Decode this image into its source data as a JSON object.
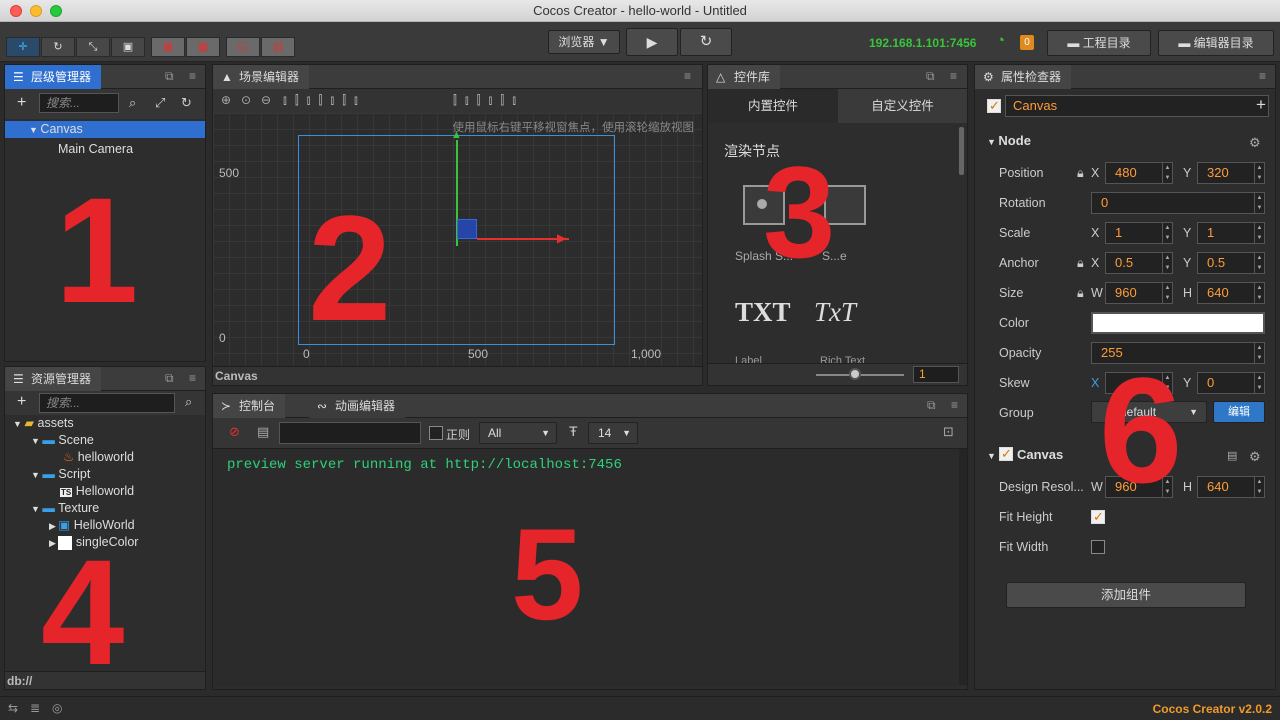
{
  "window": {
    "title": "Cocos Creator - hello-world - Untitled"
  },
  "toolbar": {
    "preview_select": "浏览器 ▼",
    "ip": "192.168.1.101:7456",
    "badge": "0",
    "project_btn": "工程目录",
    "editor_btn": "编辑器目录"
  },
  "hierarchy": {
    "tab": "层级管理器",
    "search_placeholder": "搜索...",
    "nodes": [
      "Canvas",
      "Main Camera"
    ],
    "marker": "1"
  },
  "scene": {
    "tab": "场景编辑器",
    "hint": "使用鼠标右键平移视窗焦点，使用滚轮缩放视图",
    "y_labels": [
      "500",
      "0"
    ],
    "x_labels": [
      "0",
      "500",
      "1,000"
    ],
    "footer": "Canvas",
    "marker": "2"
  },
  "widgets": {
    "tab": "控件库",
    "tab_builtin": "内置控件",
    "tab_custom": "自定义控件",
    "section": "渲染节点",
    "items": [
      "Splash S...",
      "S...e",
      "TXT",
      "TxT",
      "Label",
      "Rich Text"
    ],
    "zoom_value": "1",
    "marker": "3"
  },
  "assets": {
    "tab": "资源管理器",
    "search_placeholder": "搜索...",
    "tree": [
      "assets",
      "Scene",
      "helloworld",
      "Script",
      "Helloworld",
      "Texture",
      "HelloWorld",
      "singleColor"
    ],
    "footer": "db://",
    "marker": "4"
  },
  "console": {
    "tab": "控制台",
    "tab_anim": "动画编辑器",
    "regex_label": "正则",
    "filter": "All",
    "font_size": "14",
    "log": "preview server running at http://localhost:7456",
    "marker": "5"
  },
  "inspector": {
    "tab": "属性检查器",
    "node_name": "Canvas",
    "node_section": "Node",
    "position": {
      "label": "Position",
      "x": "480",
      "y": "320"
    },
    "rotation": {
      "label": "Rotation",
      "value": "0"
    },
    "scale": {
      "label": "Scale",
      "x": "1",
      "y": "1"
    },
    "anchor": {
      "label": "Anchor",
      "x": "0.5",
      "y": "0.5"
    },
    "size": {
      "label": "Size",
      "w": "960",
      "h": "640"
    },
    "color_label": "Color",
    "opacity": {
      "label": "Opacity",
      "value": "255"
    },
    "skew": {
      "label": "Skew",
      "y": "0"
    },
    "group": {
      "label": "Group",
      "value": "default",
      "edit": "编辑"
    },
    "canvas_section": "Canvas",
    "design": {
      "label": "Design Resol...",
      "w": "960",
      "h": "640"
    },
    "fit_height": "Fit Height",
    "fit_width": "Fit Width",
    "add_component": "添加组件",
    "marker": "6"
  },
  "status": {
    "version": "Cocos Creator v2.0.2"
  },
  "colors": {
    "accent": "#2f6fd0",
    "ip_green": "#3ac43a",
    "marker_red": "#e5252a",
    "value_orange": "#ff9c3a"
  }
}
